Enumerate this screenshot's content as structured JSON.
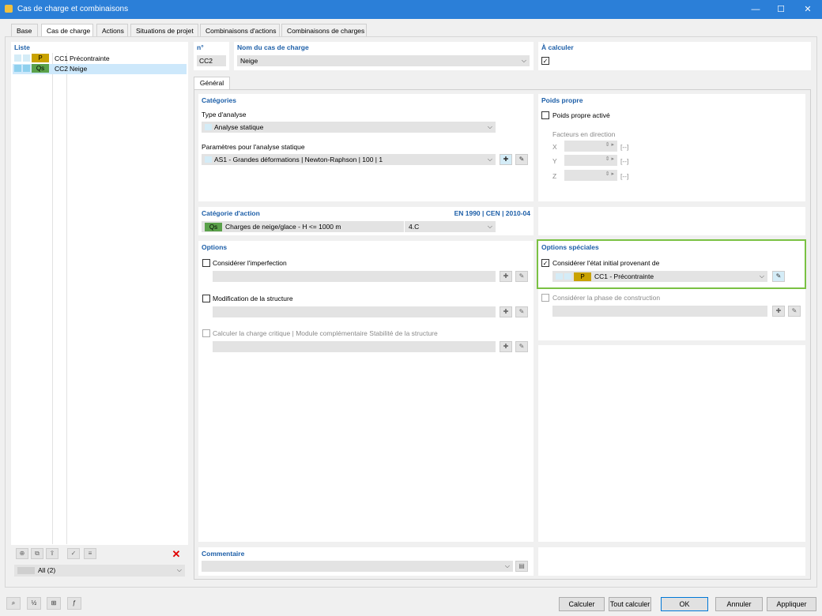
{
  "window": {
    "title": "Cas de charge et combinaisons",
    "minimize": "—",
    "maximize": "☐",
    "close": "✕"
  },
  "tabs": [
    "Base",
    "Cas de charge",
    "Actions",
    "Situations de projet",
    "Combinaisons d'actions",
    "Combinaisons de charges"
  ],
  "list": {
    "header": "Liste",
    "items": [
      {
        "code": "CC1",
        "name": "Précontrainte",
        "badge": "P",
        "badge_color": "#c9a200"
      },
      {
        "code": "CC2",
        "name": "Neige",
        "badge": "Qs",
        "badge_color": "#5aa14a"
      }
    ],
    "filter": "All (2)"
  },
  "loadcase": {
    "no_label": "n°",
    "no_value": "CC2",
    "name_label": "Nom du cas de charge",
    "name_value": "Neige",
    "calc_label": "À calculer",
    "calc_checked": "✓"
  },
  "subtab": "Général",
  "categories": {
    "header": "Catégories",
    "analysis_type_label": "Type d'analyse",
    "analysis_type_value": "Analyse statique",
    "params_label": "Paramètres pour l'analyse statique",
    "params_value": "AS1 - Grandes déformations | Newton-Raphson | 100 | 1"
  },
  "selfweight": {
    "header": "Poids propre",
    "active_label": "Poids propre activé",
    "factors_label": "Facteurs en direction",
    "axes": [
      "X",
      "Y",
      "Z"
    ],
    "unit": "[--]"
  },
  "action_category": {
    "header": "Catégorie d'action",
    "norm": "EN 1990 | CEN | 2010-04",
    "badge": "Qs",
    "value": "Charges de neige/glace - H <= 1000 m",
    "code": "4.C"
  },
  "options": {
    "header": "Options",
    "imperfection": "Considérer l'imperfection",
    "structure_mod": "Modification de la structure",
    "critical_load": "Calculer la charge critique | Module complémentaire Stabilité de la structure"
  },
  "special_options": {
    "header": "Options spéciales",
    "initial_state_label": "Considérer l'état initial provenant de",
    "initial_state_checked": "✓",
    "initial_state_badge": "P",
    "initial_state_value": "CC1 - Précontrainte",
    "construction_phase": "Considérer la phase de construction"
  },
  "comment": {
    "header": "Commentaire"
  },
  "footer": {
    "calc": "Calculer",
    "calc_all": "Tout calculer",
    "ok": "OK",
    "cancel": "Annuler",
    "apply": "Appliquer"
  },
  "accent": "#7ac143"
}
